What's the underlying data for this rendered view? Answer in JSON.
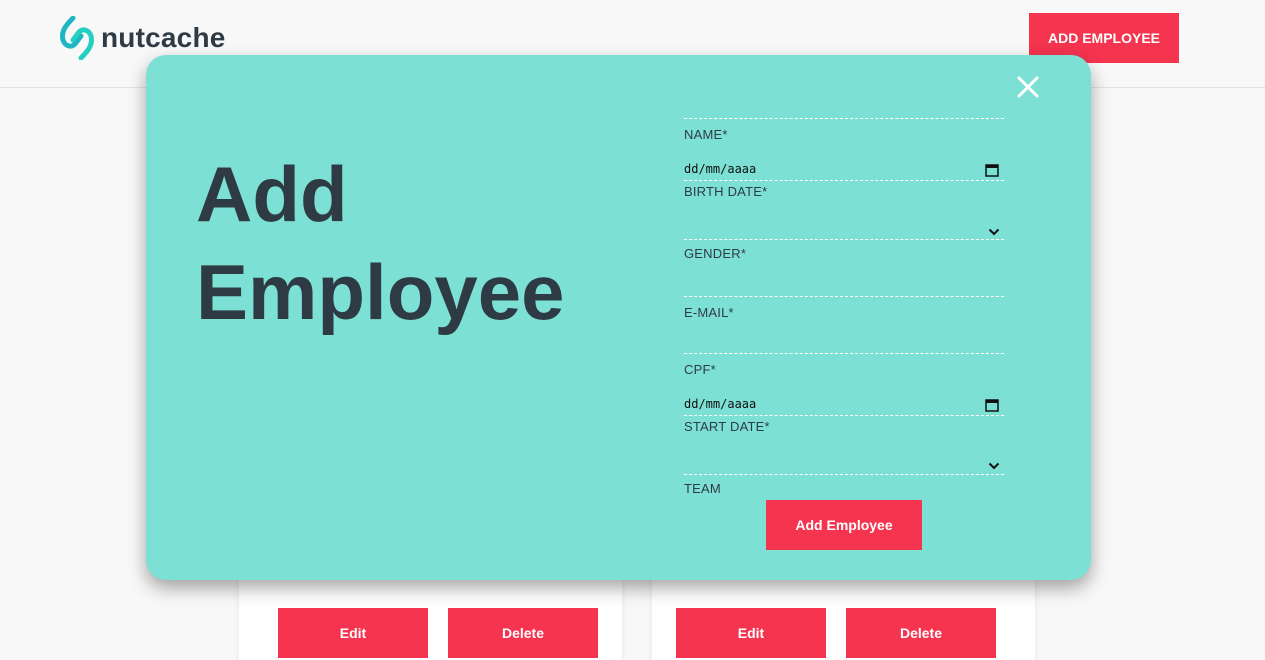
{
  "header": {
    "brand": "nutcache",
    "add_employee_label": "ADD EMPLOYEE",
    "icon": "nutcache-logo"
  },
  "cards": [
    {
      "edit_label": "Edit",
      "delete_label": "Delete"
    },
    {
      "edit_label": "Edit",
      "delete_label": "Delete"
    }
  ],
  "modal": {
    "title_line1": "Add",
    "title_line2": "Employee",
    "close_icon": "close-icon",
    "fields": {
      "name": {
        "label": "NAME*",
        "value": ""
      },
      "birth_date": {
        "label": "BIRTH DATE*",
        "value": "dd/mm/aaaa"
      },
      "gender": {
        "label": "GENDER*",
        "value": ""
      },
      "email": {
        "label": "E-MAIL*",
        "value": ""
      },
      "cpf": {
        "label": "CPF*",
        "value": ""
      },
      "start_date": {
        "label": "START DATE*",
        "value": "dd/mm/aaaa"
      },
      "team": {
        "label": "TEAM",
        "value": ""
      }
    },
    "submit_label": "Add Employee"
  },
  "colors": {
    "accent": "#f5344f",
    "modal_bg": "#7de0d4",
    "text_dark": "#2f3b44",
    "page_bg": "#f8f8f8"
  }
}
